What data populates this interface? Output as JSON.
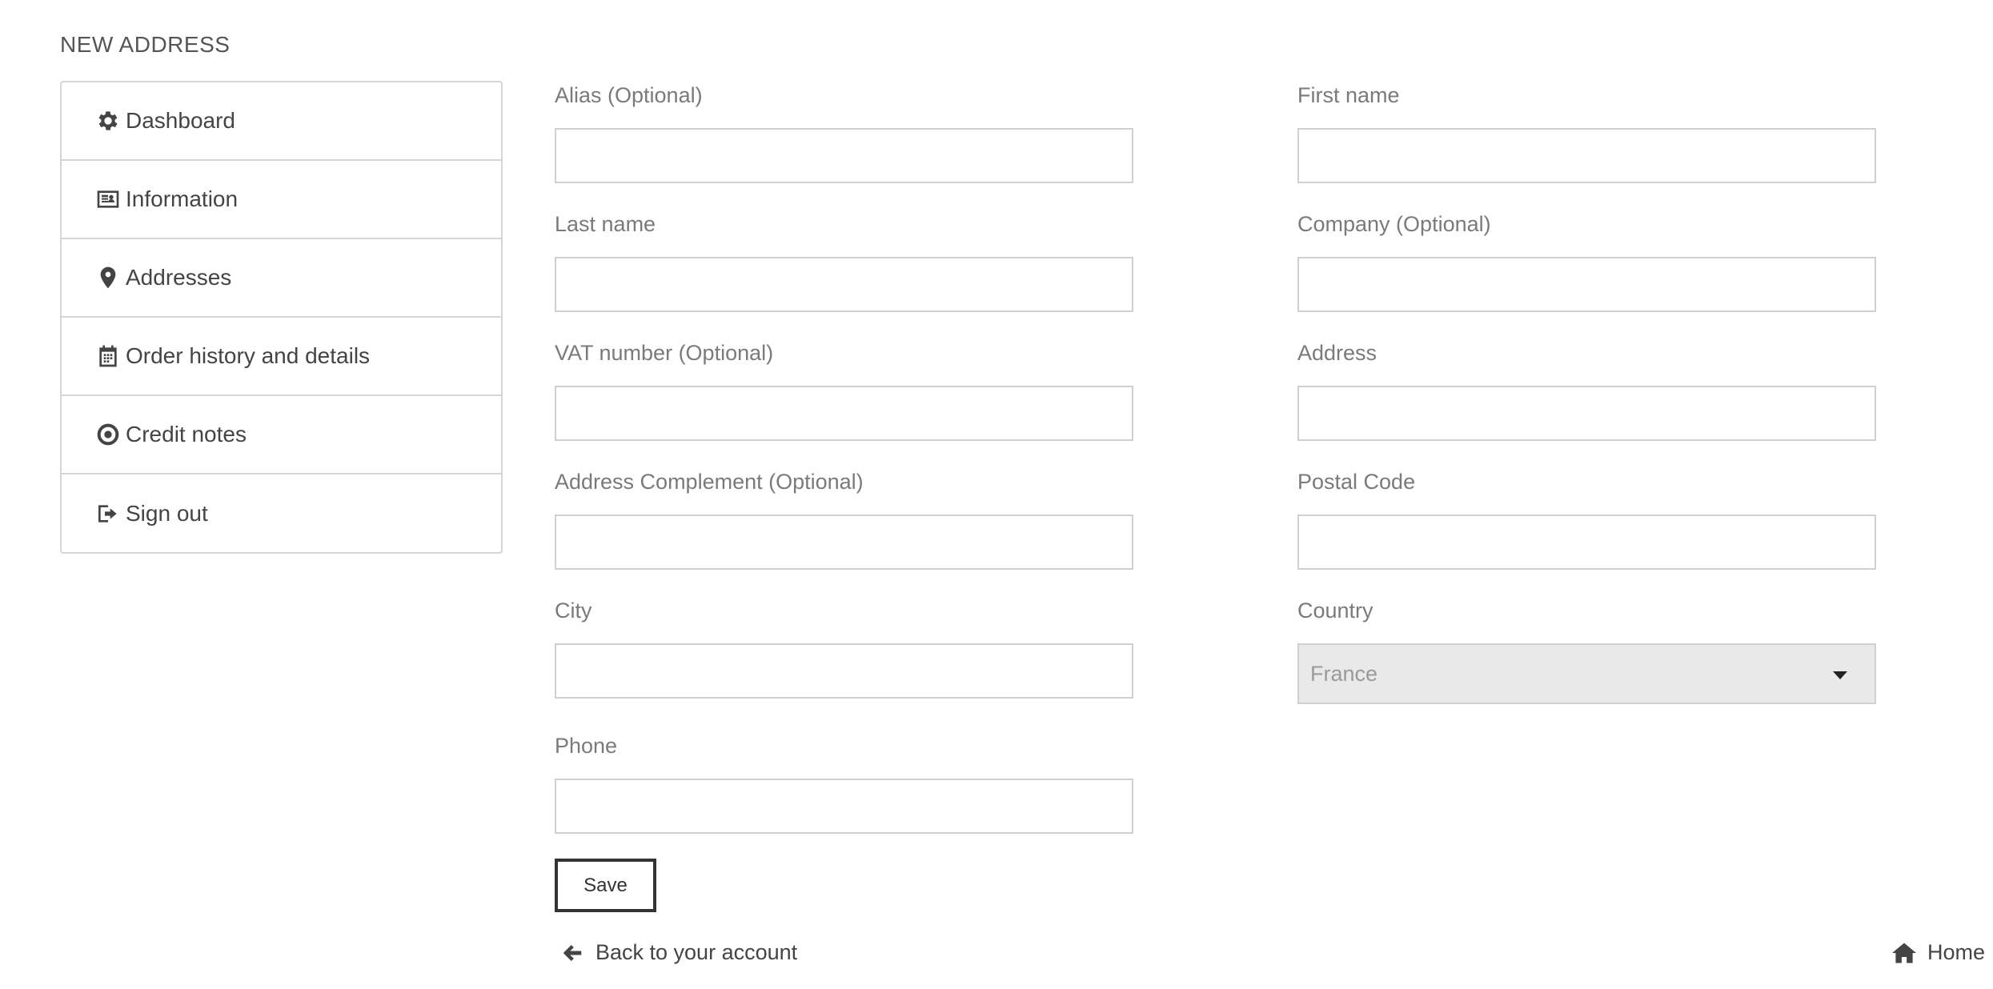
{
  "page": {
    "title": "NEW ADDRESS"
  },
  "sidebar": {
    "items": [
      {
        "label": "Dashboard",
        "icon": "gear-icon"
      },
      {
        "label": "Information",
        "icon": "id-card-icon"
      },
      {
        "label": "Addresses",
        "icon": "map-pin-icon"
      },
      {
        "label": "Order history and details",
        "icon": "calendar-icon"
      },
      {
        "label": "Credit notes",
        "icon": "circle-dot-icon"
      },
      {
        "label": "Sign out",
        "icon": "sign-out-icon"
      }
    ]
  },
  "form": {
    "alias_label": "Alias (Optional)",
    "alias_value": "",
    "first_name_label": "First name",
    "first_name_value": "",
    "last_name_label": "Last name",
    "last_name_value": "",
    "company_label": "Company (Optional)",
    "company_value": "",
    "vat_label": "VAT number (Optional)",
    "vat_value": "",
    "address_label": "Address",
    "address_value": "",
    "address_complement_label": "Address Complement (Optional)",
    "address_complement_value": "",
    "postal_code_label": "Postal Code",
    "postal_code_value": "",
    "city_label": "City",
    "city_value": "",
    "country_label": "Country",
    "country_value": "France",
    "phone_label": "Phone",
    "phone_value": "",
    "save_label": "Save"
  },
  "footer": {
    "back_label": "Back to your account",
    "home_label": "Home"
  }
}
